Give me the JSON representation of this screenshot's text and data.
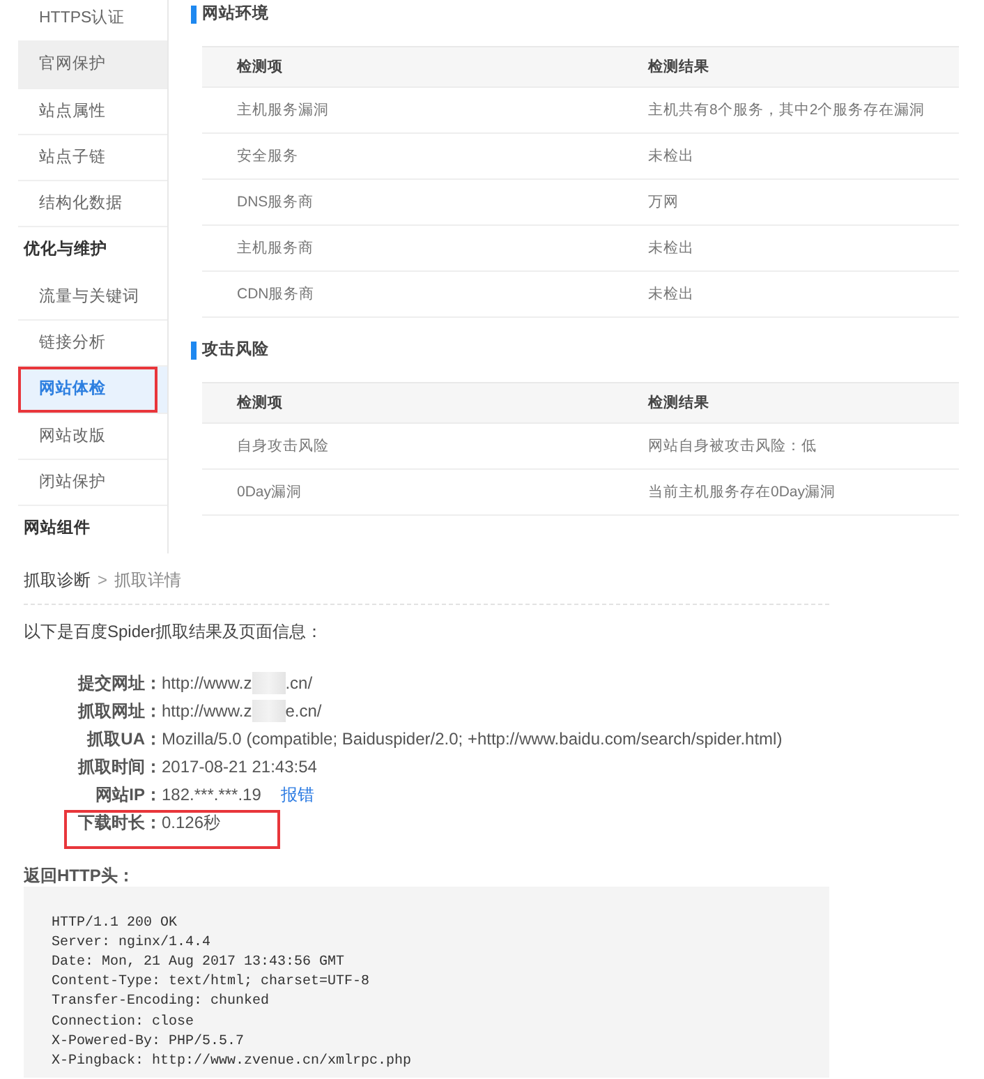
{
  "sidebar": {
    "sections": [
      {
        "items": [
          {
            "label": "HTTPS认证",
            "selected": false,
            "hover": false,
            "highlighted": false
          },
          {
            "label": "官网保护",
            "selected": false,
            "hover": true,
            "highlighted": false
          },
          {
            "label": "站点属性",
            "selected": false,
            "hover": false,
            "highlighted": false
          },
          {
            "label": "站点子链",
            "selected": false,
            "hover": false,
            "highlighted": false
          },
          {
            "label": "结构化数据",
            "selected": false,
            "hover": false,
            "highlighted": false
          }
        ]
      },
      {
        "heading": "优化与维护",
        "items": [
          {
            "label": "流量与关键词",
            "selected": false,
            "hover": false,
            "highlighted": false
          },
          {
            "label": "链接分析",
            "selected": false,
            "hover": false,
            "highlighted": false
          },
          {
            "label": "网站体检",
            "selected": true,
            "hover": false,
            "highlighted": true
          },
          {
            "label": "网站改版",
            "selected": false,
            "hover": false,
            "highlighted": false
          },
          {
            "label": "闭站保护",
            "selected": false,
            "hover": false,
            "highlighted": false
          }
        ]
      },
      {
        "heading": "网站组件"
      }
    ]
  },
  "panels": [
    {
      "title": "网站环境",
      "columns": [
        "检测项",
        "检测结果"
      ],
      "rows": [
        [
          "主机服务漏洞",
          "主机共有8个服务，其中2个服务存在漏洞"
        ],
        [
          "安全服务",
          "未检出"
        ],
        [
          "DNS服务商",
          "万网"
        ],
        [
          "主机服务商",
          "未检出"
        ],
        [
          "CDN服务商",
          "未检出"
        ]
      ]
    },
    {
      "title": "攻击风险",
      "columns": [
        "检测项",
        "检测结果"
      ],
      "rows": [
        [
          "自身攻击风险",
          "网站自身被攻击风险：低"
        ],
        [
          "0Day漏洞",
          "当前主机服务存在0Day漏洞"
        ]
      ]
    }
  ],
  "crawl_detail": {
    "breadcrumb": {
      "items": [
        {
          "label": "抓取诊断",
          "current": false
        },
        {
          "label": "抓取详情",
          "current": true
        }
      ],
      "separator": ">"
    },
    "intro": "以下是百度Spider抓取结果及页面信息：",
    "fields": [
      {
        "label": "提交网址：",
        "value": "http://www.z",
        "redacted": true,
        "value_end": ".cn/",
        "highlighted": false
      },
      {
        "label": "抓取网址：",
        "value": "http://www.z",
        "redacted": true,
        "value_end": "e.cn/",
        "highlighted": false
      },
      {
        "label": "抓取UA：",
        "value": "Mozilla/5.0 (compatible; Baiduspider/2.0; +http://www.baidu.com/search/spider.html)",
        "redacted": false,
        "highlighted": false
      },
      {
        "label": "抓取时间：",
        "value": "2017-08-21 21:43:54",
        "redacted": false,
        "highlighted": false
      },
      {
        "label": "网站IP：",
        "value": "182.***.***.19",
        "link": "报错",
        "redacted": false,
        "highlighted": false
      },
      {
        "label": "下载时长：",
        "value": "0.126秒",
        "redacted": false,
        "highlighted": true
      }
    ],
    "headers_title": "返回HTTP头：",
    "headers": [
      "HTTP/1.1 200 OK",
      "Server: nginx/1.4.4",
      "Date: Mon, 21 Aug 2017 13:43:56 GMT",
      "Content-Type: text/html; charset=UTF-8",
      "Transfer-Encoding: chunked",
      "Connection: close",
      "X-Powered-By: PHP/5.5.7",
      "X-Pingback: http://www.zvenue.cn/xmlrpc.php"
    ]
  }
}
